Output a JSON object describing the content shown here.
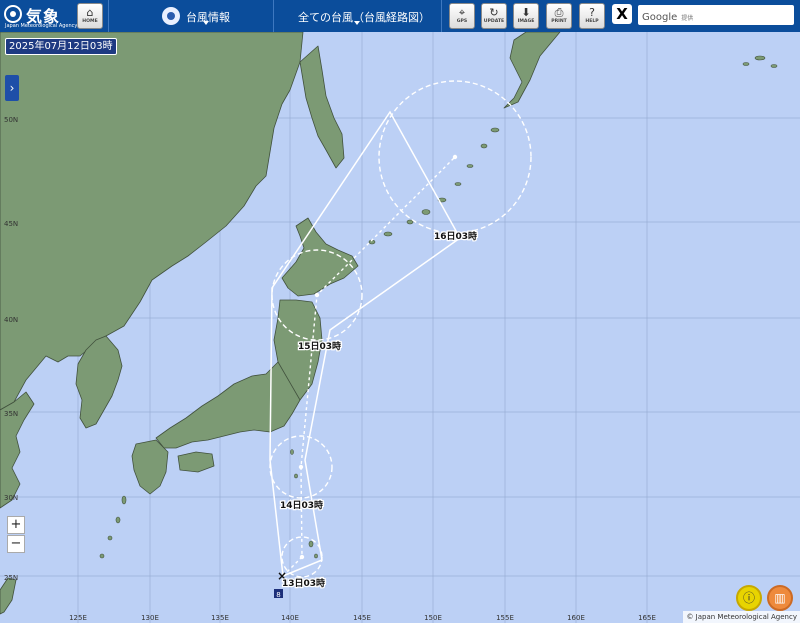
{
  "header": {
    "logo_text": "気象庁",
    "logo_sub": "Japan Meteorological Agency",
    "home_label": "HOME",
    "menu_typhoon_info": "台風情報",
    "menu_all_typhoons": "全ての台風（台風経路図）",
    "tool_buttons": [
      {
        "label": "GPS",
        "icon": "gps-icon"
      },
      {
        "label": "UPDATE",
        "icon": "update-icon"
      },
      {
        "label": "IMAGE",
        "icon": "download-icon"
      },
      {
        "label": "PRINT",
        "icon": "print-icon"
      },
      {
        "label": "HELP",
        "icon": "help-icon"
      }
    ],
    "x_label": "X",
    "search_brand": "Google",
    "search_placeholder": "提供"
  },
  "map": {
    "datetime": "2025年07月12日03時",
    "lat_labels": [
      "50N",
      "45N",
      "40N",
      "35N",
      "30N",
      "25N"
    ],
    "lon_labels": [
      "125E",
      "130E",
      "135E",
      "140E",
      "145E",
      "150E",
      "155E",
      "160E",
      "165E"
    ],
    "forecast_labels": [
      "13日03時",
      "14日03時",
      "15日03時",
      "16日03時"
    ],
    "current_marker": "×",
    "storm_tag": "8",
    "colors": {
      "sea": "#bcd0f5",
      "land": "#7c9a74",
      "coast": "#41513d",
      "track": "#ffffff"
    }
  },
  "controls": {
    "zoom_in": "+",
    "zoom_out": "−",
    "panel_toggle": "›"
  },
  "attribution": "© Japan Meteorological Agency"
}
